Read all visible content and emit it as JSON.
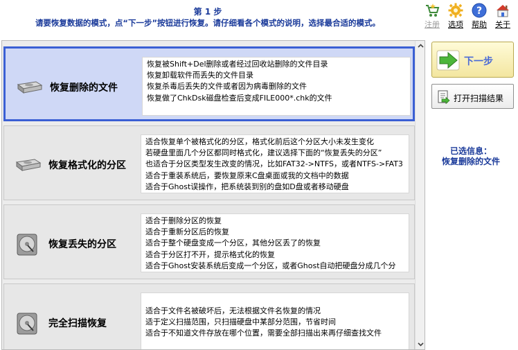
{
  "header": {
    "step_title": "第 1 步",
    "instruction": "请要恢复数据的模式，点“下一步”按钮进行恢复。请仔细看各个模式的说明，选择最合适的模式。"
  },
  "toolbar": {
    "register": "注册",
    "options": "选项",
    "help": "帮助",
    "about": "关于"
  },
  "modes": [
    {
      "title": "恢复删除的文件",
      "lines": [
        "恢复被Shift+Del删除或者经过回收站删除的文件目录",
        "恢复卸载软件而丢失的文件目录",
        "恢复杀毒后丢失的文件或者因为病毒删除的文件",
        "恢复做了ChkDsk磁盘检查后变成FILE000*.chk的文件"
      ]
    },
    {
      "title": "恢复格式化的分区",
      "lines": [
        "适合恢复单个被格式化的分区，格式化前后这个分区大小未发生变化",
        "若硬盘里面几个分区都同时格式化，建议选择下面的“恢复丢失的分区”",
        "也适合于分区类型发生改变的情况，比如FAT32->NTFS，或者NTFS->FAT3",
        "适合于重装系统后，要恢复原来C盘桌面或我的文档中的数据",
        "适合于Ghost误操作，把系统装到别的盘如D盘或者移动硬盘"
      ]
    },
    {
      "title": "恢复丢失的分区",
      "lines": [
        "适合于删除分区的恢复",
        "适合于重新分区后的恢复",
        "适合于整个硬盘变成一个分区，其他分区丢了的恢复",
        "适合于分区打不开，提示格式化的恢复",
        "适合于Ghost安装系统后变成一个分区，或者Ghost自动把硬盘分成几个分"
      ]
    },
    {
      "title": "完全扫描恢复",
      "lines": [
        "适合于文件名被破坏后，无法根据文件名恢复的情况",
        "适于定义扫描范围，只扫描硬盘中某部分范围，节省时间",
        "适合于不知道文件存放在哪个位置，需要全部扫描出来再仔细查找文件"
      ]
    }
  ],
  "side": {
    "next_label": "下一步",
    "open_scan_label": "打开扫描结果",
    "selected_prefix": "已选信息：",
    "selected_value": "恢复删除的文件"
  },
  "colors": {
    "accent": "#3a5fd4",
    "heading": "#1a3a9a"
  }
}
